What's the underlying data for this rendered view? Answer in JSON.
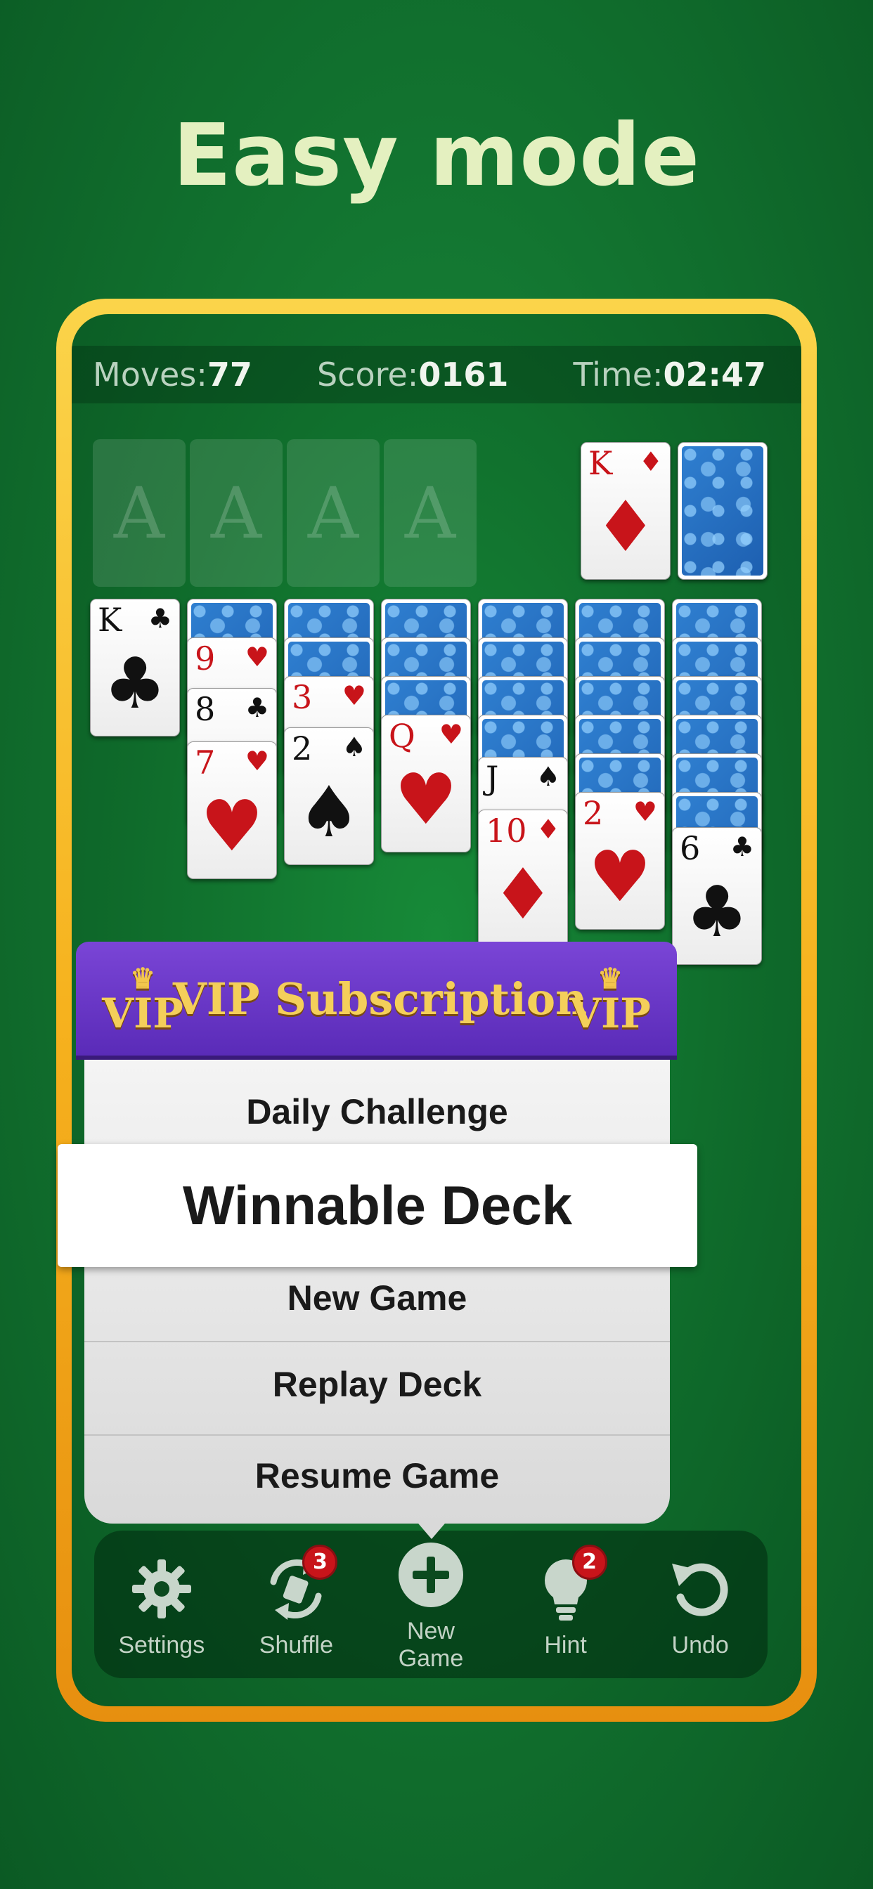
{
  "headline": "Easy mode",
  "stats": {
    "moves_label": "Moves:",
    "moves_value": "77",
    "score_label": "Score:",
    "score_value": "0161",
    "time_label": "Time:",
    "time_value": "02:47"
  },
  "foundations": [
    "A",
    "A",
    "A",
    "A"
  ],
  "waste_card": {
    "rank": "K",
    "suit": "♦",
    "color": "red"
  },
  "tableau_face_up": [
    {
      "rank": "K",
      "suit": "♣",
      "color": "black"
    },
    {
      "rank": "9",
      "suit": "♥",
      "color": "red"
    },
    {
      "rank": "8",
      "suit": "♣",
      "color": "black"
    },
    {
      "rank": "7",
      "suit": "♥",
      "color": "red"
    },
    {
      "rank": "3",
      "suit": "♥",
      "color": "red"
    },
    {
      "rank": "2",
      "suit": "♠",
      "color": "black"
    },
    {
      "rank": "Q",
      "suit": "♥",
      "color": "red"
    },
    {
      "rank": "J",
      "suit": "♠",
      "color": "black"
    },
    {
      "rank": "10",
      "suit": "♦",
      "color": "red"
    },
    {
      "rank": "2",
      "suit": "♥",
      "color": "red"
    },
    {
      "rank": "6",
      "suit": "♣",
      "color": "black"
    }
  ],
  "popup": {
    "banner_title": "VIP Subscription",
    "badge_text": "VIP",
    "items": [
      "Daily Challenge",
      "Winnable Deck",
      "New Game",
      "Replay Deck",
      "Resume Game"
    ]
  },
  "toolbar": {
    "settings": "Settings",
    "shuffle": "Shuffle",
    "shuffle_badge": "3",
    "new_game": "New Game",
    "hint": "Hint",
    "hint_badge": "2",
    "undo": "Undo"
  },
  "colors": {
    "felt": "#11702e",
    "frame": "#f6b21e",
    "vip": "#5a2bb8",
    "card_red": "#c8141a"
  }
}
